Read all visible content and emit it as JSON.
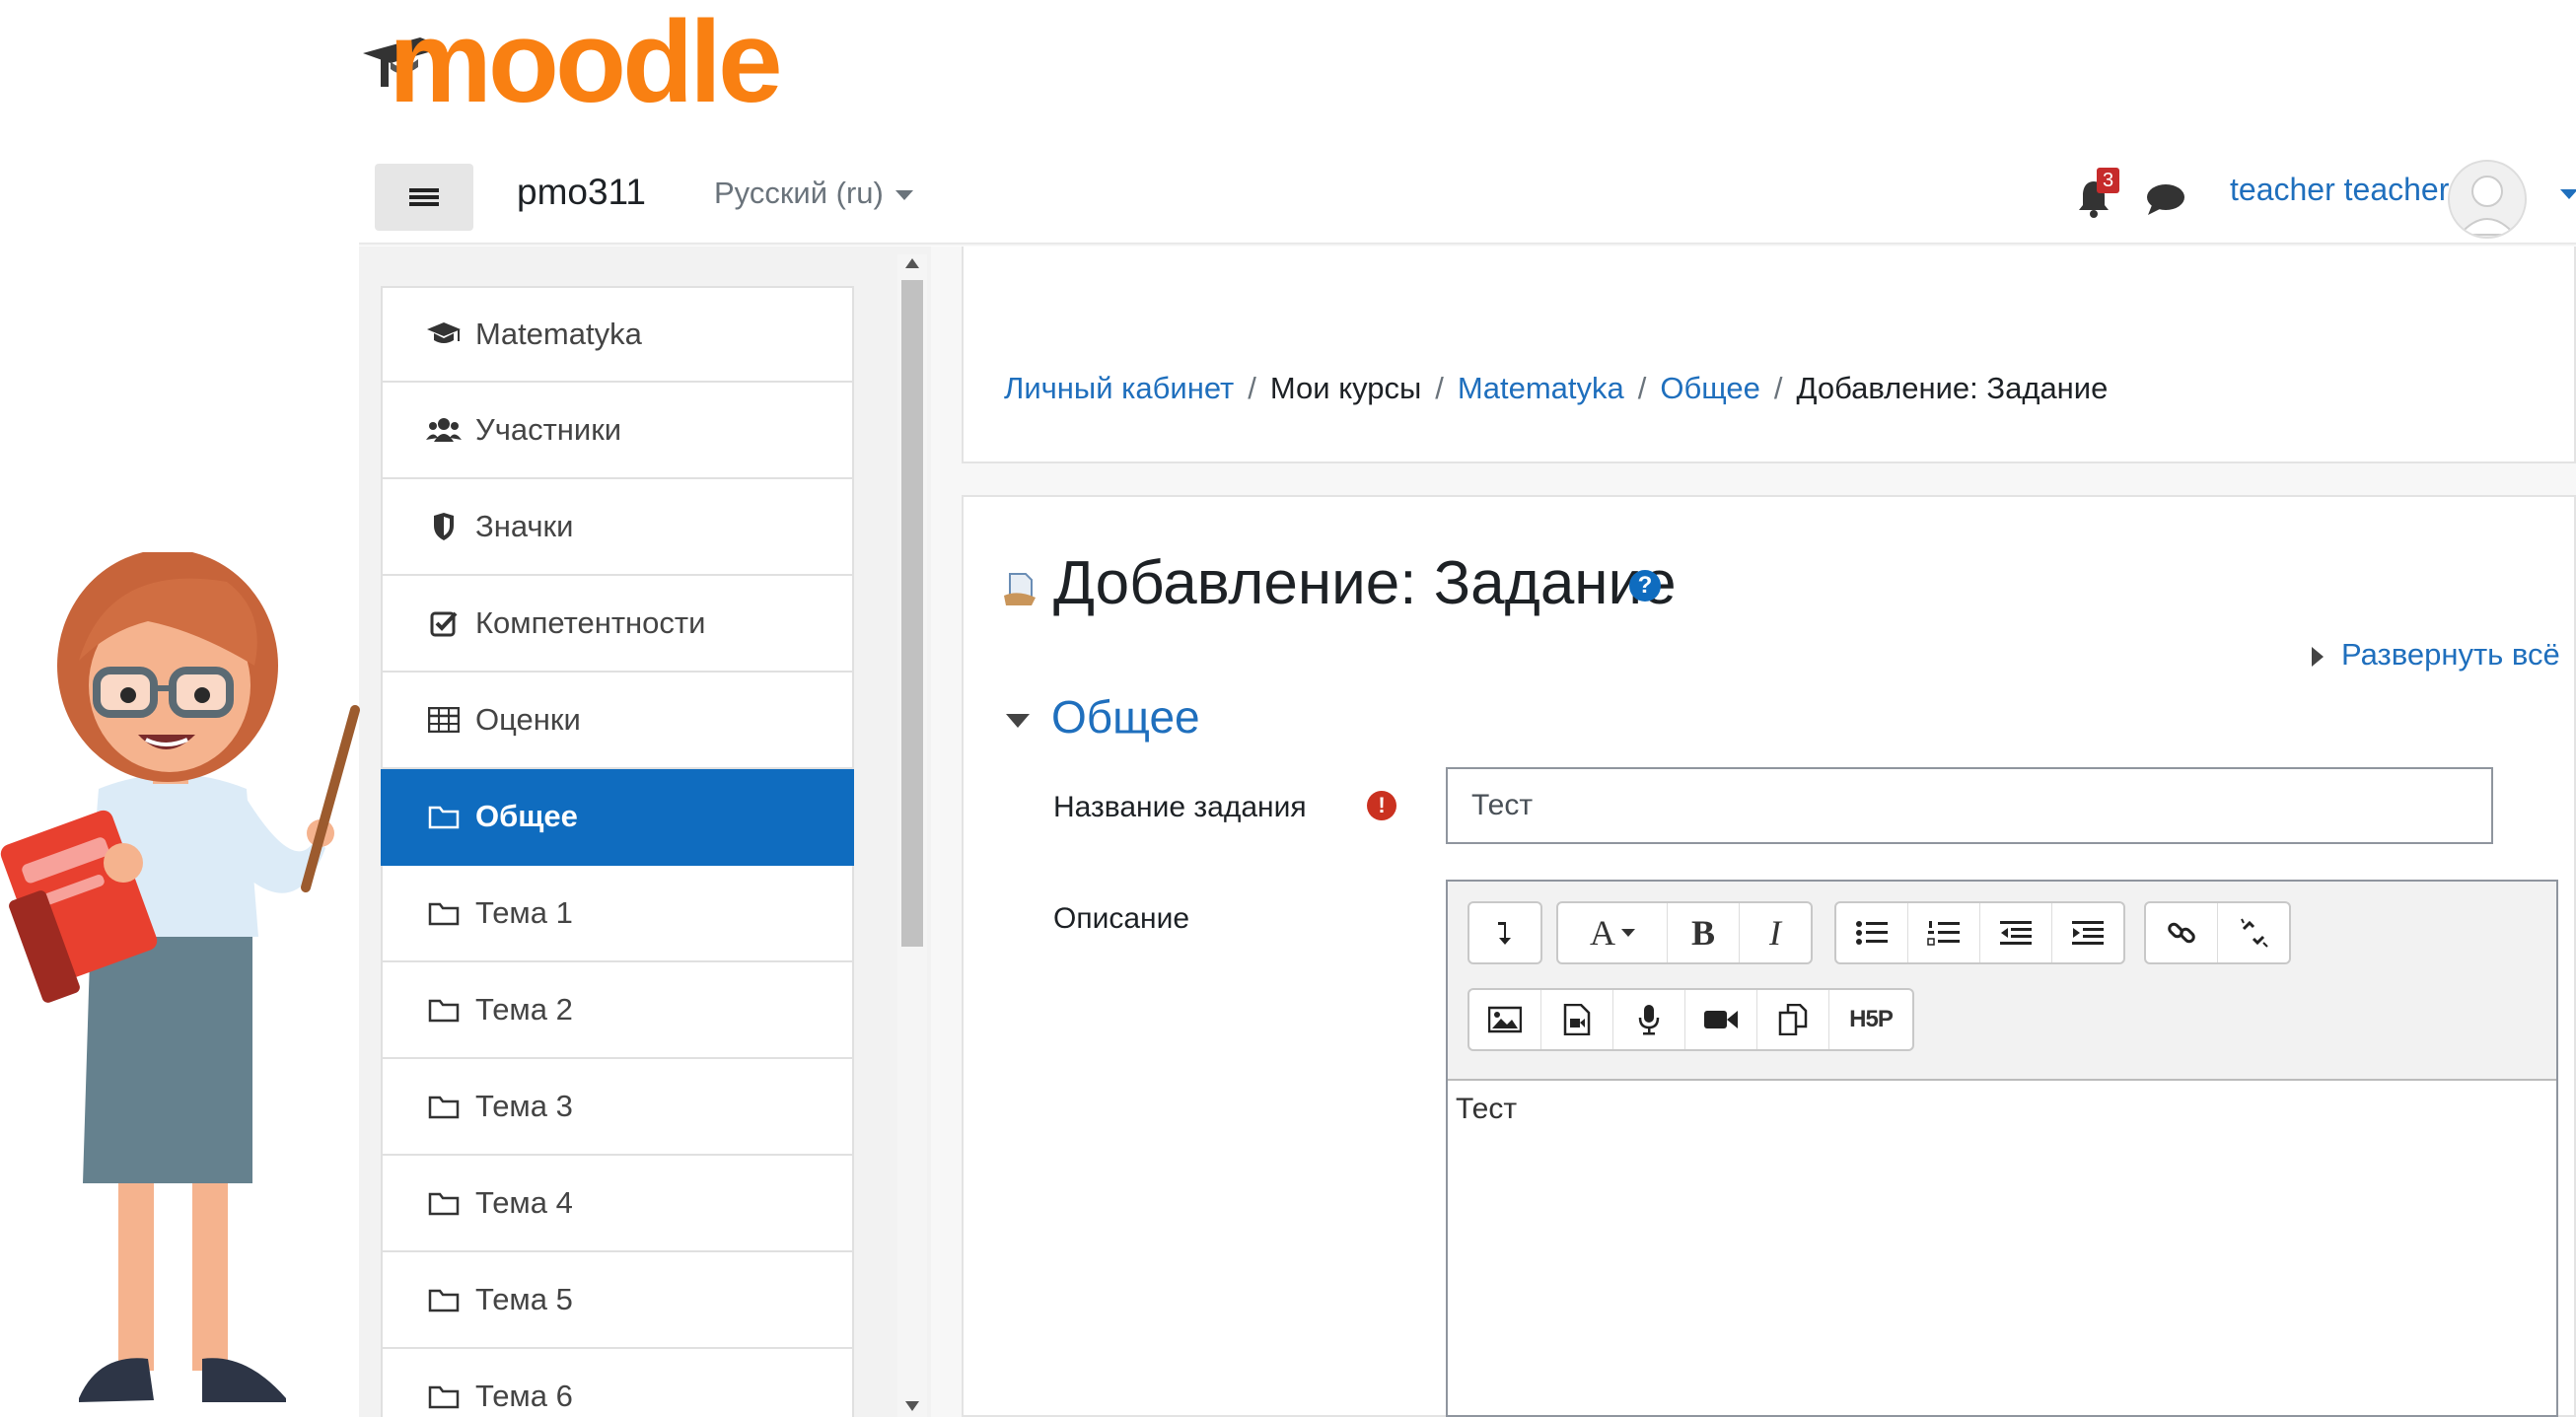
{
  "brand": {
    "logo_text": "moodle",
    "site_name": "pmo311",
    "language": "Русский (ru)",
    "accent_color": "#f98012",
    "primary_color": "#0f6cbf"
  },
  "header": {
    "notifications_count": "3",
    "user_name": "teacher teacher",
    "icons": [
      "menu-icon",
      "bell-icon",
      "chat-icon",
      "avatar-icon"
    ]
  },
  "sidebar": {
    "items": [
      {
        "label": "Matematyka",
        "icon": "graduation-cap-icon",
        "active": false
      },
      {
        "label": "Участники",
        "icon": "users-icon",
        "active": false
      },
      {
        "label": "Значки",
        "icon": "shield-icon",
        "active": false
      },
      {
        "label": "Компетентности",
        "icon": "checkbox-icon",
        "active": false
      },
      {
        "label": "Оценки",
        "icon": "table-icon",
        "active": false
      },
      {
        "label": "Общее",
        "icon": "folder-icon",
        "active": true
      },
      {
        "label": "Тема 1",
        "icon": "folder-icon",
        "active": false
      },
      {
        "label": "Тема 2",
        "icon": "folder-icon",
        "active": false
      },
      {
        "label": "Тема 3",
        "icon": "folder-icon",
        "active": false
      },
      {
        "label": "Тема 4",
        "icon": "folder-icon",
        "active": false
      },
      {
        "label": "Тема 5",
        "icon": "folder-icon",
        "active": false
      },
      {
        "label": "Тема 6",
        "icon": "folder-icon",
        "active": false
      }
    ]
  },
  "breadcrumb": {
    "items": [
      "Личный кабинет",
      "Мои курсы",
      "Matematyka",
      "Общее",
      "Добавление: Задание"
    ],
    "separator": "/"
  },
  "page": {
    "title": "Добавление: Задание",
    "help_icon": "?",
    "expand_all": "Развернуть всё",
    "section_title": "Общее"
  },
  "form": {
    "name_label": "Название задания",
    "required_icon": "!",
    "name_value": "Тест",
    "description_label": "Описание",
    "description_value": "Тест",
    "toolbar_row1": [
      "expand-toolbar-icon",
      "font-style-icon",
      "bold-icon",
      "italic-icon",
      "unordered-list-icon",
      "ordered-list-icon",
      "outdent-icon",
      "indent-icon",
      "link-icon",
      "unlink-icon"
    ],
    "toolbar_row2": [
      "image-icon",
      "media-icon",
      "record-audio-icon",
      "record-video-icon",
      "manage-files-icon",
      "h5p-icon"
    ],
    "bold_label": "B",
    "italic_label": "I",
    "font_label": "A",
    "h5p_label": "H5P"
  }
}
